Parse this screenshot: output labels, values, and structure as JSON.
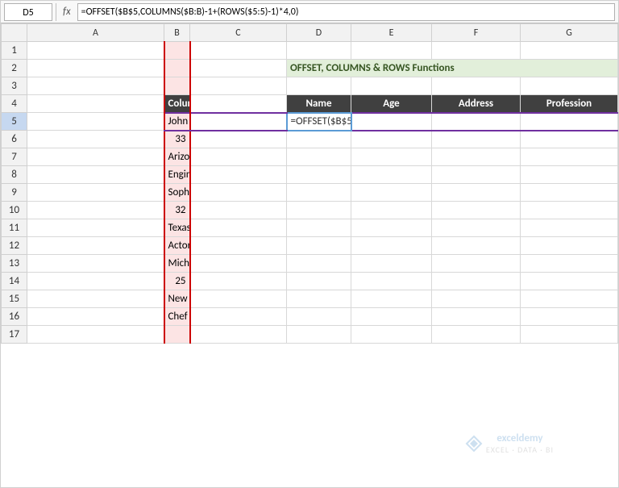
{
  "formula_bar": {
    "cell_ref": "D5",
    "fx": "fx",
    "formula": "=OFFSET($B$5,COLUMNS($B:B)-1+(ROWS($5:5)-1)*4,0)"
  },
  "columns": {
    "headers": [
      "",
      "A",
      "B",
      "C",
      "D",
      "E",
      "F",
      "G"
    ]
  },
  "rows": [
    {
      "num": "1",
      "cells": [
        "",
        "",
        "",
        "",
        "",
        "",
        ""
      ]
    },
    {
      "num": "2",
      "cells": [
        "",
        "title_span",
        "",
        "title",
        "",
        "",
        ""
      ]
    },
    {
      "num": "3",
      "cells": [
        "",
        "",
        "",
        "",
        "",
        "",
        ""
      ]
    },
    {
      "num": "4",
      "cells": [
        "",
        "col_data_header",
        "",
        "Name",
        "Age",
        "Address",
        "Profession"
      ]
    },
    {
      "num": "5",
      "cells": [
        "",
        "John",
        "",
        "formula",
        "",
        "",
        ""
      ]
    },
    {
      "num": "6",
      "cells": [
        "",
        "33",
        "",
        "",
        "",
        "",
        ""
      ]
    },
    {
      "num": "7",
      "cells": [
        "",
        "Arizona",
        "",
        "",
        "",
        "",
        ""
      ]
    },
    {
      "num": "8",
      "cells": [
        "",
        "Engineer",
        "",
        "",
        "",
        "",
        ""
      ]
    },
    {
      "num": "9",
      "cells": [
        "",
        "Sophie",
        "",
        "",
        "",
        "",
        ""
      ]
    },
    {
      "num": "10",
      "cells": [
        "",
        "32",
        "",
        "",
        "",
        "",
        ""
      ]
    },
    {
      "num": "11",
      "cells": [
        "",
        "Texas",
        "",
        "",
        "",
        "",
        ""
      ]
    },
    {
      "num": "12",
      "cells": [
        "",
        "Actor",
        "",
        "",
        "",
        "",
        ""
      ]
    },
    {
      "num": "13",
      "cells": [
        "",
        "Michel",
        "",
        "",
        "",
        "",
        ""
      ]
    },
    {
      "num": "14",
      "cells": [
        "",
        "25",
        "",
        "",
        "",
        "",
        ""
      ]
    },
    {
      "num": "15",
      "cells": [
        "",
        "New York",
        "",
        "",
        "",
        "",
        ""
      ]
    },
    {
      "num": "16",
      "cells": [
        "",
        "Chef",
        "",
        "",
        "",
        "",
        ""
      ]
    },
    {
      "num": "17",
      "cells": [
        "",
        "",
        "",
        "",
        "",
        "",
        ""
      ]
    }
  ],
  "title": "OFFSET, COLUMNS & ROWS Functions",
  "col_data_header": "Column Data",
  "watermark": {
    "logo": "exceldemy",
    "sub": "EXCEL · DATA · BI"
  }
}
